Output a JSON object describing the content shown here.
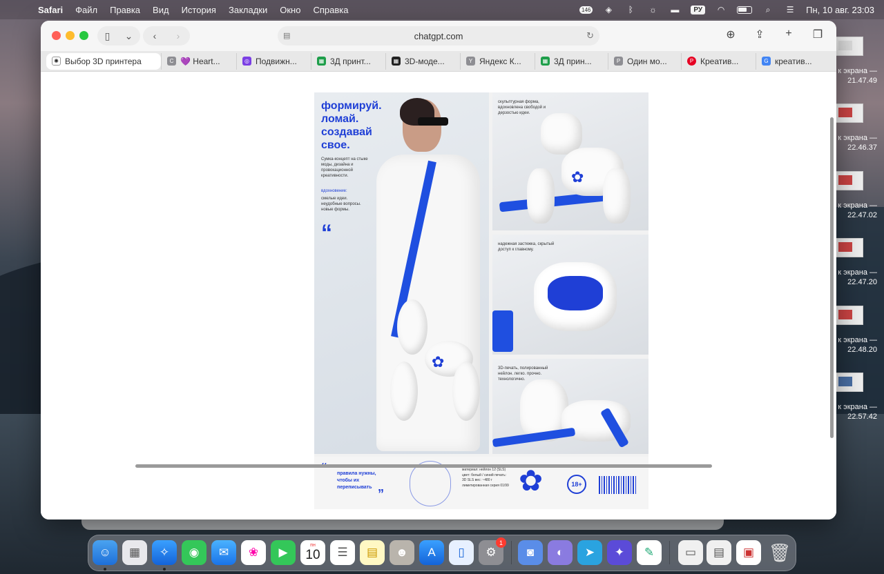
{
  "menubar": {
    "app": "Safari",
    "items": [
      "Файл",
      "Правка",
      "Вид",
      "История",
      "Закладки",
      "Окно",
      "Справка"
    ],
    "notif_count": "146",
    "lang": "РУ",
    "datetime": "Пн, 10 авг.  23:03"
  },
  "desktop_files": [
    {
      "line1": "к экрана —",
      "line2": "21.47.49"
    },
    {
      "line1": "к экрана —",
      "line2": "22.46.37"
    },
    {
      "line1": "к экрана —",
      "line2": "22.47.02"
    },
    {
      "line1": "к экрана —",
      "line2": "22.47.20"
    },
    {
      "line1": "к экрана —",
      "line2": "22.48.20"
    },
    {
      "line1": "к экрана —",
      "line2": "22.57.42"
    }
  ],
  "toolbar": {
    "url": "chatgpt.com"
  },
  "tabs": [
    {
      "label": "Выбор 3D принтера",
      "fav": "✺",
      "fav_color": "#ffffff",
      "fav_text_color": "#222222"
    },
    {
      "label": "💜 Heart...",
      "fav": "C",
      "fav_color": "#8e8e93"
    },
    {
      "label": "Подвижн...",
      "fav": "◎",
      "fav_color": "#7b3fe4"
    },
    {
      "label": "3Д принт...",
      "fav": "▦",
      "fav_color": "#1e9e4a"
    },
    {
      "label": "3D-моде...",
      "fav": "▦",
      "fav_color": "#222222"
    },
    {
      "label": "Яндекс К...",
      "fav": "Y",
      "fav_color": "#8e8e93"
    },
    {
      "label": "3Д прин...",
      "fav": "▦",
      "fav_color": "#1e9e4a"
    },
    {
      "label": "Один мо...",
      "fav": "P",
      "fav_color": "#8e8e93"
    },
    {
      "label": "Креатив...",
      "fav": "P",
      "fav_color": "#e60023"
    },
    {
      "label": "креатив...",
      "fav": "G",
      "fav_color": "#4285f4"
    }
  ],
  "poster": {
    "title": "формируй. ломай. создавай свое.",
    "subtitle": "Сумка-концепт на стыке моды, дизайна и провокационной креативности.",
    "inspiration_title": "вдохновение:",
    "inspiration": "смелые идеи. неудобные вопросы. новые формы.",
    "quote_mark": "“",
    "panel1_caption": "скульптурная форма, вдохновлена свободой и дерзостью идеи.",
    "panel2_caption": "надежная застежка, скрытый доступ к главному.",
    "panel3_caption": "3D-печать, полированный нейлон. легко. прочно. технологично.",
    "footer_quote": "правила нужны, чтобы их переписывать",
    "footer_quote_open": "“",
    "footer_quote_close": "”",
    "spec": "материал: нейлон 12 (SLS) цвет: белый / синий печать: 3D SLS вес: ~480 г лимитированная серия 01/99",
    "age": "18+",
    "flower": "✿"
  },
  "dock": {
    "calendar_month": "пн",
    "calendar_day": "10",
    "settings_badge": "1"
  },
  "colors": {
    "accent_blue": "#1f3fd6"
  }
}
